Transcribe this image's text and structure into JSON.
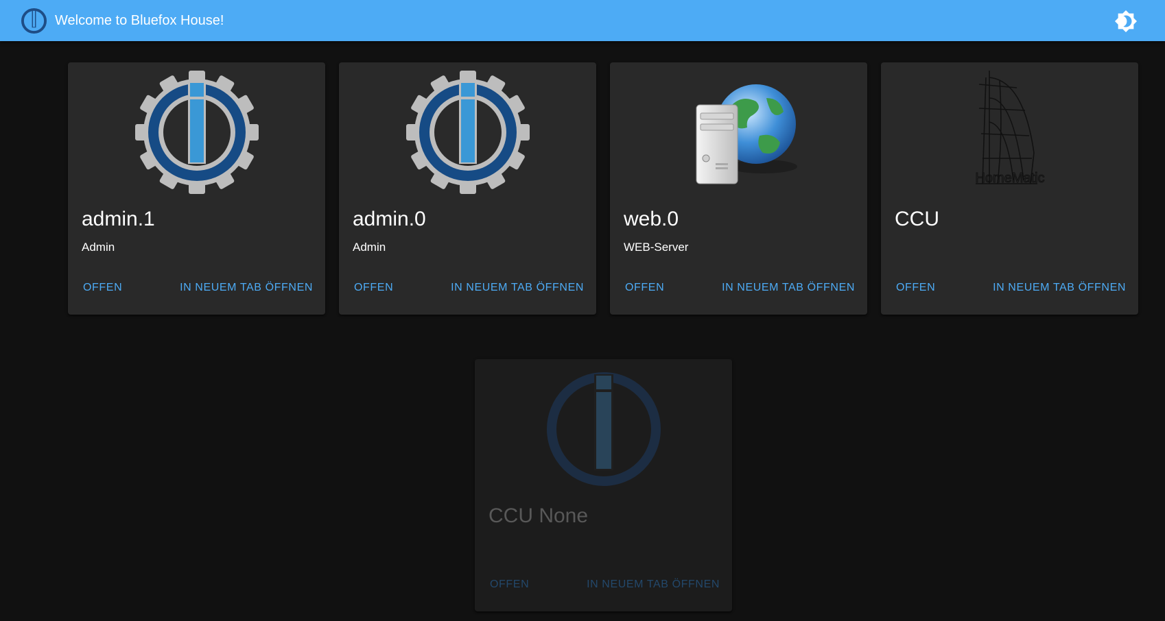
{
  "appbar": {
    "title": "Welcome to Bluefox House!",
    "logo_icon": "iobroker-logo-icon",
    "theme_toggle_icon": "brightness-icon",
    "background": "#4dabf5"
  },
  "colors": {
    "accent": "#4dabf5",
    "page_bg": "#111111",
    "card_bg": "#292929"
  },
  "cards": [
    {
      "title": "admin.1",
      "subtitle": "Admin",
      "icon": "iobroker-gear-icon",
      "open_label": "OFFEN",
      "new_tab_label": "IN NEUEM TAB ÖFFNEN",
      "enabled": true
    },
    {
      "title": "admin.0",
      "subtitle": "Admin",
      "icon": "iobroker-gear-icon",
      "open_label": "OFFEN",
      "new_tab_label": "IN NEUEM TAB ÖFFNEN",
      "enabled": true
    },
    {
      "title": "web.0",
      "subtitle": "WEB-Server",
      "icon": "web-server-globe-icon",
      "open_label": "OFFEN",
      "new_tab_label": "IN NEUEM TAB ÖFFNEN",
      "enabled": true
    },
    {
      "title": "CCU",
      "subtitle": "",
      "icon": "homematic-icon",
      "logo_text": "HomeMatic",
      "open_label": "OFFEN",
      "new_tab_label": "IN NEUEM TAB ÖFFNEN",
      "enabled": true
    },
    {
      "title": "CCU None",
      "subtitle": "",
      "icon": "iobroker-logo-icon",
      "open_label": "OFFEN",
      "new_tab_label": "IN NEUEM TAB ÖFFNEN",
      "enabled": false
    }
  ]
}
